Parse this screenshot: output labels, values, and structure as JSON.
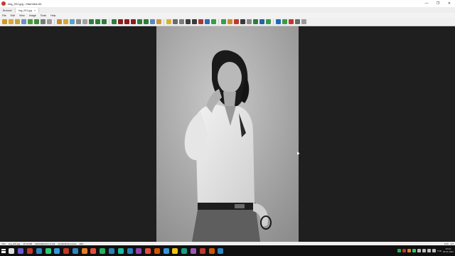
{
  "window": {
    "title": "img_001.jpg - IrfanView 64",
    "controls": [
      "—",
      "❐",
      "✕"
    ]
  },
  "tabs": [
    {
      "label": "Browser",
      "active": false
    },
    {
      "label": "img_001.jpg",
      "active": true
    }
  ],
  "menu": [
    "File",
    "Edit",
    "View",
    "Image",
    "Tools",
    "Help"
  ],
  "toolbar": {
    "colors": [
      "#c99a2e",
      "#d9a441",
      "#c8a23a",
      "#6b8fc9",
      "#4e9a3c",
      "#3e8f3b",
      "#7a7a7a",
      "#9a9a9a",
      "#c98b2e",
      "#d4a63a",
      "#5aa0d0",
      "#8a8a8a",
      "#a0a0a0",
      "#2f7d3a",
      "#2f7d3a",
      "#2f7d3a",
      "#2f7d3a",
      "#8b1e1e",
      "#8b1e1e",
      "#8b1e1e",
      "#2f7d3a",
      "#2f7d3a",
      "#5a88c0",
      "#c89a3a",
      "#d6b43a",
      "#6b6b6b",
      "#7c7c7c",
      "#3c3c3c",
      "#3c3c3c",
      "#a33b3b",
      "#2b6fb0",
      "#3a9b4a",
      "#3a9b4a",
      "#d08b2e",
      "#c0392b",
      "#3a3a3a",
      "#8a8a8a",
      "#2f7d3a",
      "#2b5fa8",
      "#3a9b4a",
      "#1e6bb8",
      "#3a9b4a",
      "#c0392b",
      "#6b6b6b",
      "#9a9a9a"
    ]
  },
  "status": {
    "left": [
      "7/21",
      "img_001.jpg",
      "15.70 MB",
      "4024x6624x24 (1.50)",
      "23.09x38.00 inches",
      "28%"
    ],
    "right": [
      "27%",
      "1/1"
    ]
  },
  "taskbar": {
    "icons": [
      "#e0e0e0",
      "#6a5acd",
      "#c0392b",
      "#2e86c1",
      "#2ecc71",
      "#3498db",
      "#c0392b",
      "#2e86c1",
      "#e67e22",
      "#e74c3c",
      "#27ae60",
      "#2980b9",
      "#1abc9c",
      "#2980b9",
      "#8e44ad",
      "#e74c3c",
      "#d35400",
      "#3498db",
      "#f1c40f",
      "#16a085",
      "#9b59b6",
      "#c0392b",
      "#d35400",
      "#2e86c1"
    ],
    "tray_icons": [
      "#27ae60",
      "#c0392b",
      "#e67e22",
      "#2ecc71",
      "#bbbbbb",
      "#bbbbbb",
      "#bbbbbb",
      "#bbbbbb"
    ],
    "lang": "TUR",
    "time": "07:10",
    "date": "06.01.2022"
  }
}
